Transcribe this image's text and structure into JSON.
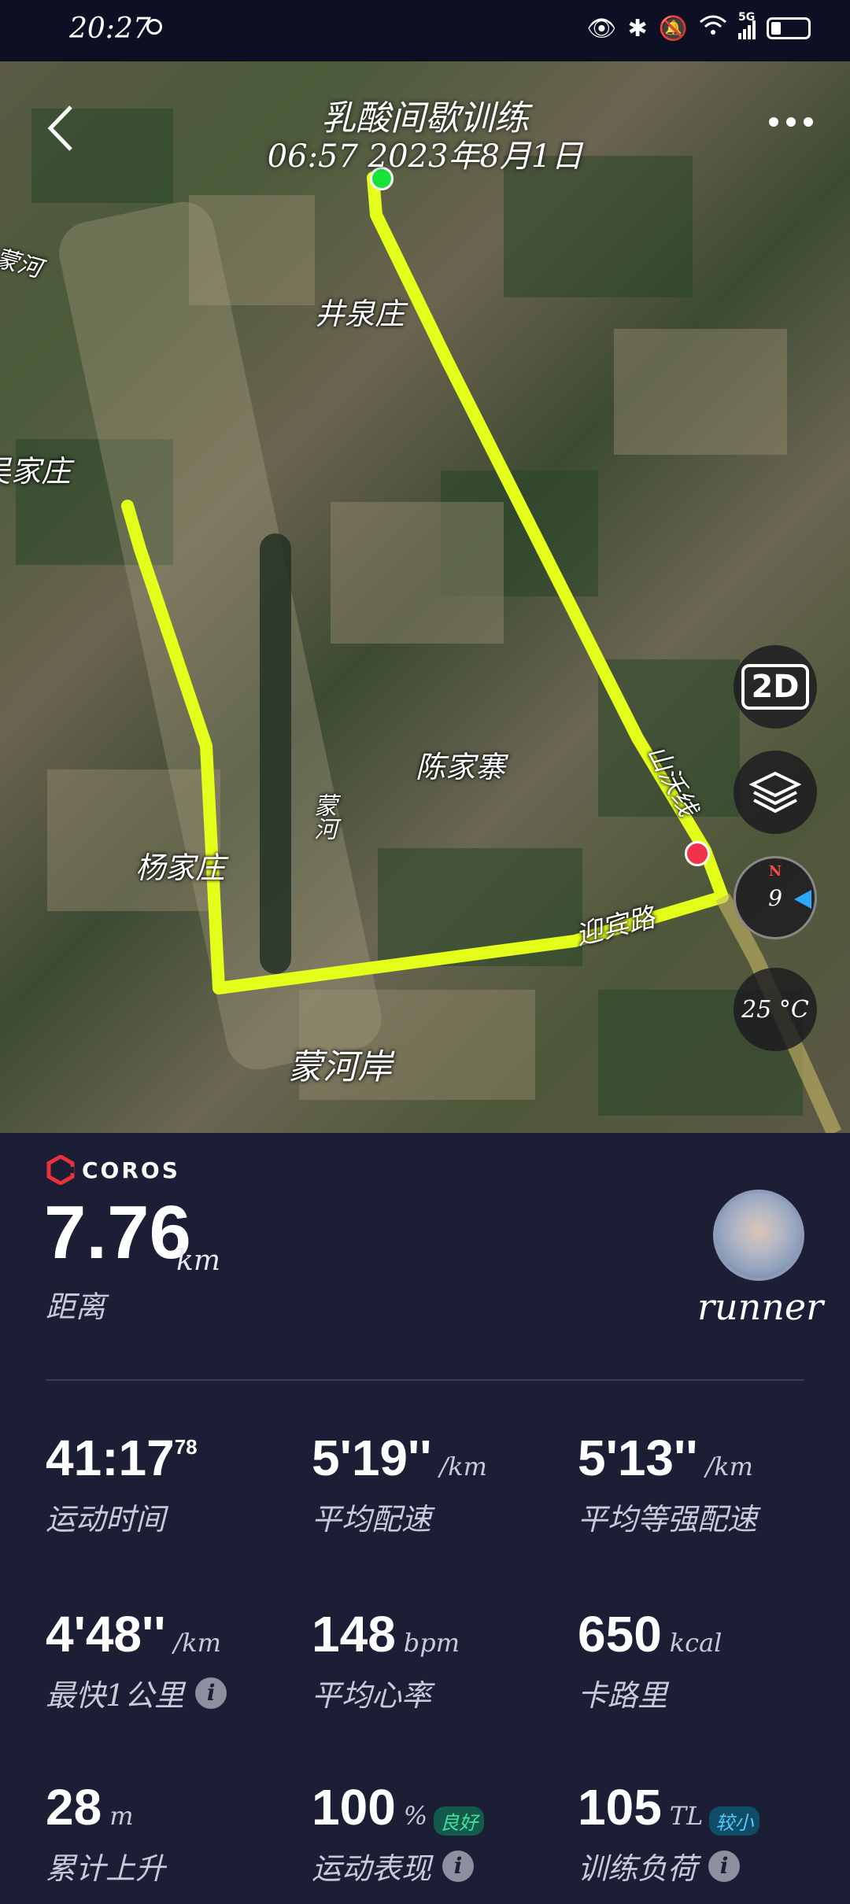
{
  "status_bar": {
    "time": "20:27",
    "network": "5G"
  },
  "map": {
    "title": "乳酸间歇训练",
    "date": "06:57 2023年8月1日",
    "labels": [
      "井泉庄",
      "蒙河",
      "吴家庄",
      "陈家寨",
      "蒙河",
      "杨家庄",
      "迎宾路",
      "蒙河岸",
      "山沃线"
    ],
    "controls": {
      "view_mode": "2D",
      "compass_value": "9",
      "compass_north": "N",
      "temperature": "25 °C"
    }
  },
  "colors": {
    "route": "#e4ff1a",
    "start": "#17e23a",
    "end": "#f0324a",
    "card_bg": "#1b1e34"
  },
  "summary": {
    "brand": "COROS",
    "distance_value": "7.76",
    "distance_unit": "km",
    "distance_label": "距离",
    "username": "runner"
  },
  "stats": [
    {
      "value": "41:17",
      "sup": "78",
      "unit": "",
      "label": "运动时间",
      "info": false,
      "badge": ""
    },
    {
      "value": "5'19''",
      "sup": "",
      "unit": "/km",
      "label": "平均配速",
      "info": false,
      "badge": ""
    },
    {
      "value": "5'13''",
      "sup": "",
      "unit": "/km",
      "label": "平均等强配速",
      "info": false,
      "badge": ""
    },
    {
      "value": "4'48''",
      "sup": "",
      "unit": "/km",
      "label": "最快1公里",
      "info": true,
      "badge": ""
    },
    {
      "value": "148",
      "sup": "",
      "unit": "bpm",
      "label": "平均心率",
      "info": false,
      "badge": ""
    },
    {
      "value": "650",
      "sup": "",
      "unit": "kcal",
      "label": "卡路里",
      "info": false,
      "badge": ""
    },
    {
      "value": "28",
      "sup": "",
      "unit": "m",
      "label": "累计上升",
      "info": false,
      "badge": ""
    },
    {
      "value": "100",
      "sup": "",
      "unit": "%",
      "label": "运动表现",
      "info": true,
      "badge": "良好"
    },
    {
      "value": "105",
      "sup": "",
      "unit": "TL",
      "label": "训练负荷",
      "info": true,
      "badge": "较小"
    }
  ]
}
